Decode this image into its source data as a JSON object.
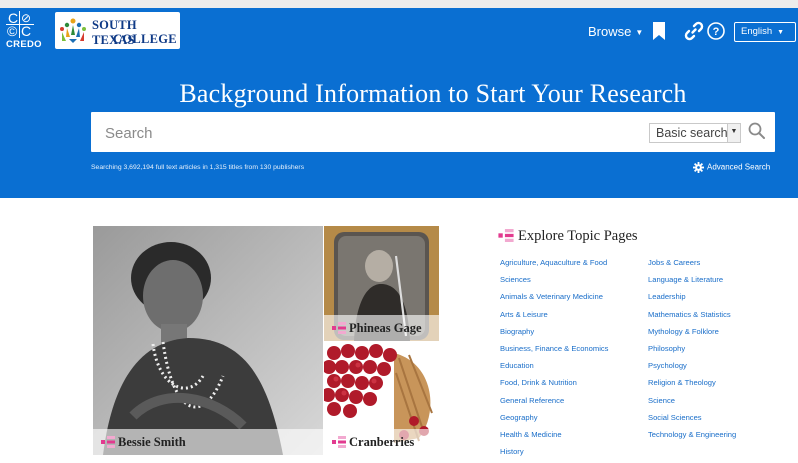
{
  "header": {
    "logo_word": "CREDO",
    "logo_glyphs": [
      "C",
      "⊘",
      "©",
      "C"
    ],
    "institution_line1": "SOUTH TEXAS",
    "institution_line2": "COLLEGE",
    "browse_label": "Browse",
    "language_label": "English",
    "icons": [
      "bookmark-icon",
      "link-icon",
      "help-icon"
    ]
  },
  "hero": {
    "title": "Background Information to Start Your Research",
    "search_placeholder": "Search",
    "search_mode": "Basic search",
    "stats": "Searching 3,692,194 full text articles in 1,315 titles from 130 publishers",
    "advanced_label": "Advanced Search"
  },
  "featured": [
    {
      "label": "Bessie Smith"
    },
    {
      "label": "Phineas Gage"
    },
    {
      "label": "Cranberries"
    }
  ],
  "topics": {
    "title": "Explore Topic Pages",
    "col1": [
      "Agriculture, Aquaculture & Food",
      "Sciences",
      "Animals & Veterinary Medicine",
      "Arts & Leisure",
      "Biography",
      "Business, Finance & Economics",
      "Education",
      "Food, Drink & Nutrition",
      "General Reference",
      "Geography",
      "Health & Medicine",
      "History"
    ],
    "col2": [
      "Jobs & Careers",
      "Language & Literature",
      "Leadership",
      "Mathematics & Statistics",
      "Mythology & Folklore",
      "Philosophy",
      "Psychology",
      "Religion & Theology",
      "Science",
      "Social Sciences",
      "Technology & Engineering"
    ]
  },
  "colors": {
    "band": "#0a6fd2",
    "link": "#1a6ec9",
    "topic_icon_a": "#e23a8f",
    "topic_icon_b": "#f2a9d0"
  }
}
